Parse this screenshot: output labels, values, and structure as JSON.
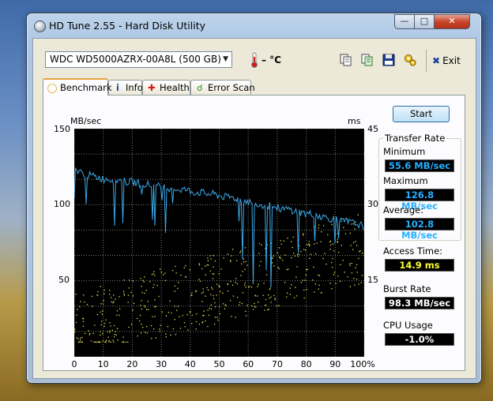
{
  "window": {
    "title": "HD Tune 2.55 - Hard Disk Utility"
  },
  "toolbar": {
    "drive": "WDC WD5000AZRX-00A8L (500 GB)",
    "temperature": "– °C",
    "exit_label": "Exit",
    "icons": [
      "copy-icon",
      "copy-all-icon",
      "save-icon",
      "options-icon"
    ]
  },
  "tabs": [
    {
      "label": "Benchmark",
      "icon": "bulb-icon",
      "active": true
    },
    {
      "label": "Info",
      "icon": "info-icon"
    },
    {
      "label": "Health",
      "icon": "health-cross-icon"
    },
    {
      "label": "Error Scan",
      "icon": "magnifier-icon"
    }
  ],
  "chart": {
    "left_unit": "MB/sec",
    "right_unit": "ms",
    "left_ticks": [
      "150",
      "100",
      "50"
    ],
    "right_ticks": [
      "45",
      "30",
      "15"
    ],
    "x_ticks": [
      "0",
      "10",
      "20",
      "30",
      "40",
      "50",
      "60",
      "70",
      "80",
      "90",
      "100%"
    ]
  },
  "chart_data": {
    "type": "line",
    "x": [
      0,
      1,
      2,
      4,
      6,
      8,
      10,
      12,
      14,
      16,
      18,
      20,
      22,
      24,
      26,
      28,
      30,
      32,
      34,
      36,
      38,
      40,
      42,
      44,
      46,
      48,
      50,
      52,
      54,
      56,
      58,
      60,
      62,
      64,
      66,
      68,
      70,
      72,
      74,
      76,
      78,
      80,
      82,
      84,
      86,
      88,
      90,
      92,
      94,
      96,
      98,
      100
    ],
    "series": [
      {
        "values": [
          126,
          122,
          121,
          120,
          119,
          118,
          117,
          117,
          116,
          116,
          115,
          115,
          114,
          114,
          113,
          112,
          112,
          111,
          111,
          110,
          110,
          109,
          108,
          108,
          107,
          107,
          106,
          105,
          105,
          104,
          103,
          102,
          101,
          100,
          100,
          99,
          98,
          97,
          97,
          96,
          95,
          94,
          94,
          93,
          92,
          91,
          90,
          89,
          89,
          88,
          87,
          86
        ]
      }
    ],
    "secondary_series": {
      "type": "scatter",
      "axis": "right",
      "description_range_ms": [
        3,
        30
      ]
    },
    "ylim_left": [
      0,
      150
    ],
    "ylim_right": [
      0,
      45
    ],
    "xlim": [
      0,
      100
    ],
    "grid": true
  },
  "actions": {
    "start_label": "Start"
  },
  "stats": {
    "transfer_rate_title": "Transfer Rate",
    "minimum_label": "Minimum",
    "minimum_value": "55.6 MB/sec",
    "maximum_label": "Maximum",
    "maximum_value": "126.8 MB/sec",
    "average_label": "Average:",
    "average_value": "102.8 MB/sec",
    "access_time_label": "Access Time:",
    "access_time_value": "14.9 ms",
    "burst_rate_label": "Burst Rate",
    "burst_rate_value": "98.3 MB/sec",
    "cpu_usage_label": "CPU Usage",
    "cpu_usage_value": "-1.0%"
  },
  "colors": {
    "line": "#3aa8e8",
    "scatter": "#e8e850",
    "grid": "#7a7a7a",
    "chart_bg": "#000000"
  }
}
